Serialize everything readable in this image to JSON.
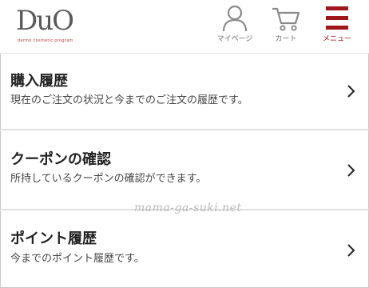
{
  "header": {
    "logo": {
      "mark": "DuO",
      "tagline": "dermo cosmetic program",
      "icon": "duo-logo"
    },
    "nav": {
      "mypage": {
        "label": "マイページ",
        "icon": "person-icon"
      },
      "cart": {
        "label": "カート",
        "icon": "cart-icon"
      },
      "menu": {
        "label": "メニュー",
        "icon": "hamburger-icon"
      }
    },
    "accent_color": "#a0161b"
  },
  "menu_rows": [
    {
      "title": "購入履歴",
      "description": "現在のご注文の状況と今までのご注文の履歴です。",
      "icon": "chevron-right-icon"
    },
    {
      "title": "クーポンの確認",
      "description": "所持しているクーポンの確認ができます。",
      "icon": "chevron-right-icon"
    },
    {
      "title": "ポイント履歴",
      "description": "今までのポイント履歴です。",
      "icon": "chevron-right-icon"
    }
  ],
  "watermark": "mama-ga-suki.net"
}
